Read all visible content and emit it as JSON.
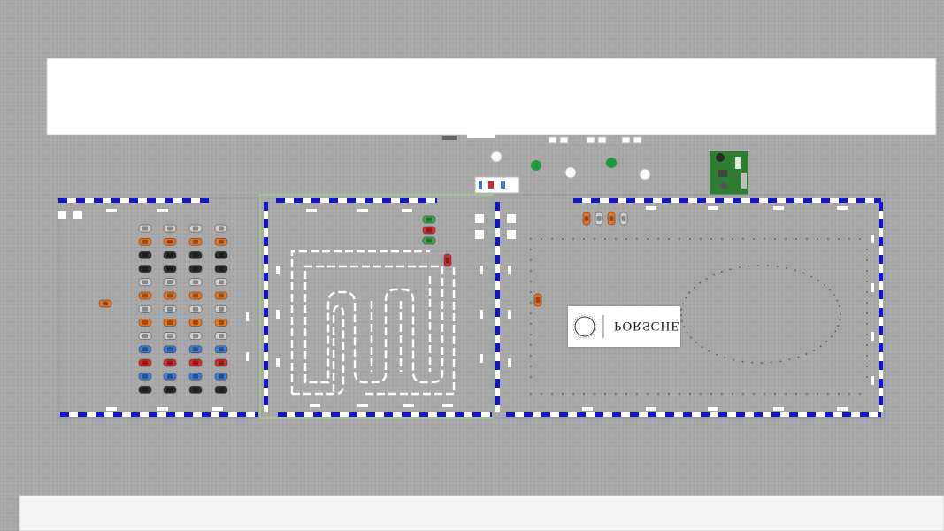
{
  "scene": {
    "description_colors": {
      "ground": "#a7a7a7",
      "building": "#ffffff",
      "barrier_blue": "#1414c8",
      "barrier_white": "#ffffff",
      "car_orange": "#e8731c",
      "car_silver": "#cfcfcf",
      "car_black": "#2b2b2b",
      "car_blue": "#3a7bd5",
      "car_red": "#d22b2b",
      "car_green": "#3aa845",
      "green_area": "#2f7d32"
    },
    "icons": [
      "car-icon",
      "cone-icon",
      "tent-icon",
      "tree-icon",
      "table-icon"
    ]
  },
  "sign": {
    "brand": "PORSCHE"
  }
}
